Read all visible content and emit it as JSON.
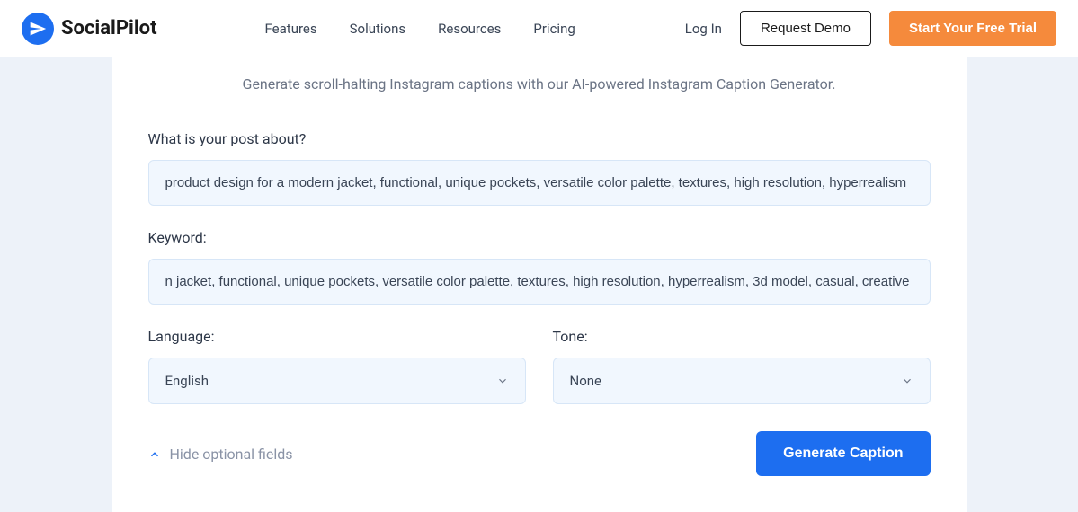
{
  "brand": {
    "name": "SocialPilot"
  },
  "nav": {
    "features": "Features",
    "solutions": "Solutions",
    "resources": "Resources",
    "pricing": "Pricing"
  },
  "auth": {
    "login": "Log In",
    "demo": "Request Demo",
    "trial": "Start Your Free Trial"
  },
  "main": {
    "subtitle": "Generate scroll-halting Instagram captions with our AI-powered Instagram Caption Generator.",
    "about_label": "What is your post about?",
    "about_value": "product design for a modern jacket, functional, unique pockets, versatile color palette, textures, high resolution, hyperrealism",
    "keyword_label": "Keyword:",
    "keyword_value": "n jacket, functional, unique pockets, versatile color palette, textures, high resolution, hyperrealism, 3d model, casual, creative",
    "language_label": "Language:",
    "language_value": "English",
    "tone_label": "Tone:",
    "tone_value": "None",
    "hide_fields": "Hide optional fields",
    "generate": "Generate Caption"
  }
}
